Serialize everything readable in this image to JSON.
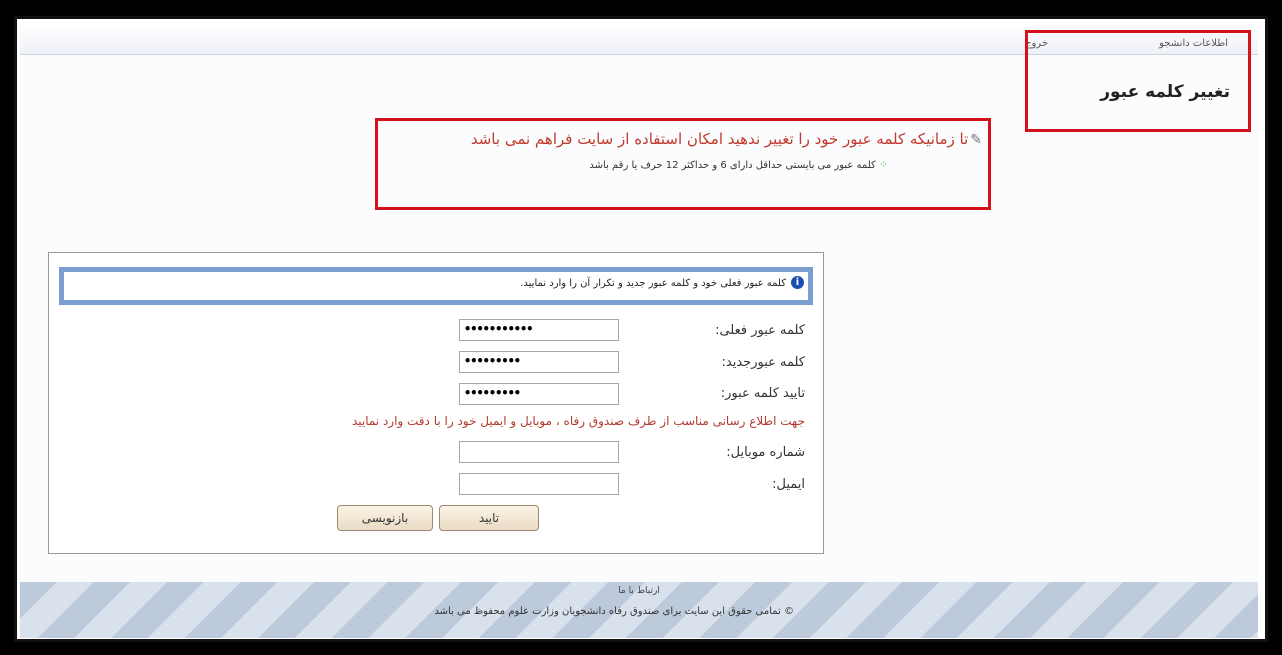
{
  "topnav": {
    "student_info": "اطلاعات دانشجو",
    "exit": "خروج"
  },
  "page_title": "تغییر کلمه عبور",
  "warning": {
    "main": "تا زمانیکه کلمه عبور خود را تغییر ندهید امکان استفاده از سایت فراهم نمی باشد",
    "sub": "کلمه عبور می بایستی حداقل دارای 6 و حداکثر 12 حرف یا رقم باشد"
  },
  "form": {
    "info": "کلمه عبور فعلی خود و کلمه عبور جدید و تکرار آن را وارد نمایید.",
    "current_password_label": "کلمه عبور فعلی:",
    "current_password_value": "•••••••••••",
    "new_password_label": "کلمه عبورجدید:",
    "new_password_value": "•••••••••",
    "confirm_password_label": "تایید کلمه عبور:",
    "confirm_password_value": "•••••••••",
    "notice": "جهت اطلاع رسانی مناسب از طرف صندوق رفاه ، موبایل و ایمیل خود را با دقت وارد نمایید",
    "mobile_label": "شماره موبایل:",
    "mobile_value": "",
    "email_label": "ایمیل:",
    "email_value": "",
    "confirm_button": "تایید",
    "reset_button": "بازنویسی"
  },
  "footer": {
    "contact": "ارتباط با ما",
    "copyright": "© تمامی حقوق این سایت برای صندوق رفاه دانشجویان وزارت علوم محفوظ می باشد"
  },
  "colors": {
    "highlight_border": "#d4121c",
    "warning_text": "#c0392b",
    "info_bar": "#7b9ed1"
  }
}
